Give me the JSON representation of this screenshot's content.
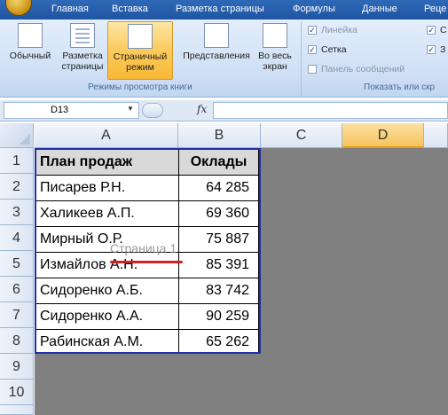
{
  "tabs": [
    "Главная",
    "Вставка",
    "Разметка страницы",
    "Формулы",
    "Данные",
    "Реце"
  ],
  "ribbon": {
    "view_buttons": [
      {
        "line1": "Обычный",
        "line2": ""
      },
      {
        "line1": "Разметка",
        "line2": "страницы"
      },
      {
        "line1": "Страничный",
        "line2": "режим"
      },
      {
        "line1": "Представления",
        "line2": ""
      },
      {
        "line1": "Во весь",
        "line2": "экран"
      }
    ],
    "view_group_label": "Режимы просмотра книги",
    "show_items": [
      {
        "label": "Линейка",
        "checked": true,
        "enabled": false
      },
      {
        "label": "Сетка",
        "checked": true,
        "enabled": true
      },
      {
        "label": "Панель сообщений",
        "checked": false,
        "enabled": false
      }
    ],
    "show_items_cut": [
      "С",
      "З"
    ],
    "show_group_label": "Показать или скр"
  },
  "formula_bar": {
    "name_box": "D13",
    "fx": "fx",
    "formula": ""
  },
  "grid": {
    "columns": [
      "A",
      "B",
      "C",
      "D"
    ],
    "selected_column": "D",
    "rows": [
      "1",
      "2",
      "3",
      "4",
      "5",
      "6",
      "7",
      "8",
      "9",
      "10"
    ],
    "table": [
      [
        "План продаж",
        "Оклады"
      ],
      [
        "Писарев Р.Н.",
        "64 285"
      ],
      [
        "Халикеев А.П.",
        "69 360"
      ],
      [
        "Мирный О.Р.",
        "75 887"
      ],
      [
        "Измайлов А.Н.",
        "85 391"
      ],
      [
        "Сидоренко А.Б.",
        "83 742"
      ],
      [
        "Сидоренко А.А.",
        "90 259"
      ],
      [
        "Рабинская А.М.",
        "65 262"
      ]
    ],
    "page_watermark": "Страница 1"
  },
  "colors": {
    "tab_bar": "#2e69b8",
    "active_button": "#f8b834",
    "annotation_red": "#d81e1e",
    "page_border": "#1f2fa5",
    "gray_outside_page": "#808080"
  }
}
